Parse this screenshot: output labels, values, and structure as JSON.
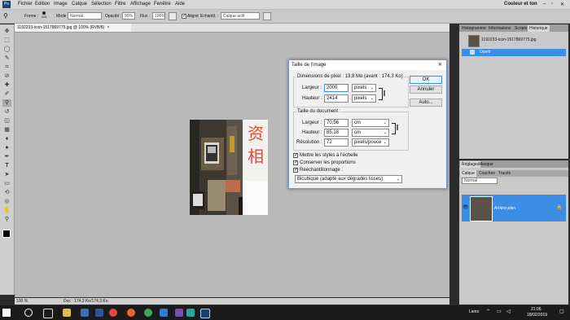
{
  "menu": [
    "Fichier",
    "Edition",
    "Image",
    "Calque",
    "Sélection",
    "Filtre",
    "Affichage",
    "Fenêtre",
    "Aide"
  ],
  "workspace": "Couleur et ton",
  "options": {
    "forme_label": "Forme :",
    "brush_size": "415",
    "mode_label": "Mode :",
    "mode_value": "Normal",
    "opacity_label": "Opacité :",
    "opacity_value": "90%",
    "flux_label": "Flux :",
    "flux_value": "100%",
    "aligne_label": "Aligné",
    "echant_label": "Echantil. :",
    "echant_value": "Calque actif"
  },
  "document": {
    "tab": "1192233-icon-1517869775.jpg @ 100% (RVB/8)",
    "status_zoom": "100 %",
    "status_doc": "Doc : 174,3 Ko/174,3 Ko"
  },
  "history": {
    "tabs": [
      "Histogramme",
      "Informations",
      "Scripts",
      "Historique"
    ],
    "snapshot": "1192233-icon-1517869775.jpg",
    "step": "Ouvrir"
  },
  "adjust": {
    "tabs": [
      "Réglages",
      "Masque"
    ],
    "layer_tabs": [
      "Calque",
      "Couches",
      "Tracés"
    ],
    "blend": "Normal",
    "layer_name": "Arrière-plan"
  },
  "dialog": {
    "title": "Taille de l'image",
    "pixel_dims": "Dimensions de pixel : 13,8 Mo (avant : 174,3 Ko)",
    "largeur_label": "Largeur :",
    "hauteur_label": "Hauteur :",
    "px_width": "2000",
    "px_height": "2414",
    "px_unit": "pixels",
    "doc_size": "Taille du document :",
    "doc_width": "70,56",
    "doc_height": "85,18",
    "doc_unit": "cm",
    "resolution_label": "Résolution :",
    "resolution": "72",
    "res_unit": "pixels/pouce",
    "ok": "OK",
    "cancel": "Annuler",
    "auto": "Auto...",
    "cb1": "Mettre les styles à l'échelle",
    "cb2": "Conserver les proportions",
    "cb3": "Rééchantillonnage :",
    "resample": "Bicubique (adapté aux dégradés lisses)"
  },
  "taskbar": {
    "lang": "Liens",
    "time": "21:06",
    "date": "18/02/2019"
  },
  "colors": {
    "accent": "#3a8ee6",
    "dialog_border": "#7a96c9"
  }
}
